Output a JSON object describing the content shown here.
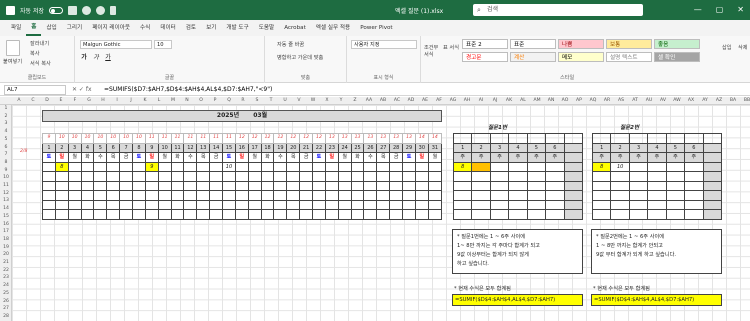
{
  "titlebar": {
    "autosave_label": "자동 저장",
    "filename": "엑셀 질문 (1).xlsx",
    "search_placeholder": "검색",
    "minimize": "—",
    "maximize": "▢",
    "close": "✕"
  },
  "menu": {
    "tabs": [
      "파일",
      "홈",
      "삽입",
      "그리기",
      "페이지 레이아웃",
      "수식",
      "데이터",
      "검토",
      "보기",
      "개발 도구",
      "도움말",
      "Acrobat",
      "엑셀 실무 적용",
      "Power Pivot"
    ],
    "active_index": 1
  },
  "ribbon": {
    "clipboard": {
      "paste": "붙여넣기",
      "cut": "잘라내기",
      "copy": "복사",
      "format_painter": "서식 복사",
      "label": "클립보드"
    },
    "font": {
      "name": "Malgun Gothic",
      "size": "10",
      "bold": "가",
      "italic": "가",
      "underline": "가",
      "label": "글꼴"
    },
    "alignment": {
      "wrap": "자동 줄 바꿈",
      "merge": "병합하고 가운데 맞춤",
      "label": "맞춤"
    },
    "number": {
      "format": "사용자 지정",
      "label": "표시 형식"
    },
    "conditional_format": "조건부 서식",
    "format_as_table": "표 서식",
    "styles": {
      "label": "스타일",
      "items": [
        {
          "text": "표준 2",
          "bg": "#ffffff",
          "color": "#000000"
        },
        {
          "text": "표준",
          "bg": "#ffffff",
          "color": "#000000"
        },
        {
          "text": "나쁨",
          "bg": "#ffc7ce",
          "color": "#9c0006"
        },
        {
          "text": "보통",
          "bg": "#ffeb9c",
          "color": "#9c5700"
        },
        {
          "text": "좋음",
          "bg": "#c6efce",
          "color": "#006100"
        },
        {
          "text": "경고문",
          "bg": "#ffffff",
          "color": "#ff0000"
        },
        {
          "text": "계산",
          "bg": "#f2f2f2",
          "color": "#fa7d00"
        },
        {
          "text": "메모",
          "bg": "#ffffcc",
          "color": "#000000"
        },
        {
          "text": "설명 텍스트",
          "bg": "#ffffff",
          "color": "#7f7f7f"
        },
        {
          "text": "셀 확인",
          "bg": "#a5a5a5",
          "color": "#ffffff"
        }
      ]
    },
    "insert": "삽입",
    "delete": "삭제"
  },
  "formula_bar": {
    "name_box": "AL7",
    "formula": "=SUMIFS($D7:$AH7,$D$4:$AH$4,AL$4,$D7:$AH7,\"<9\")"
  },
  "columns": [
    "A",
    "C",
    "D",
    "E",
    "F",
    "G",
    "H",
    "I",
    "J",
    "K",
    "L",
    "M",
    "N",
    "O",
    "P",
    "Q",
    "R",
    "S",
    "T",
    "U",
    "V",
    "W",
    "X",
    "Y",
    "Z",
    "AA",
    "AB",
    "AC",
    "AD",
    "AE",
    "AF",
    "AG",
    "AH",
    "AI",
    "AJ",
    "AK",
    "AL",
    "AM",
    "AN",
    "AO",
    "AP",
    "AQ",
    "AR",
    "AS",
    "AT",
    "AU",
    "AV",
    "AW",
    "AX",
    "AY",
    "AZ",
    "BA",
    "BB"
  ],
  "rows": [
    "1",
    "2",
    "3",
    "4",
    "5",
    "6",
    "7",
    "8",
    "9",
    "10",
    "11",
    "12",
    "13",
    "14",
    "15",
    "16",
    "17",
    "18",
    "19",
    "20",
    "21",
    "22",
    "23",
    "24",
    "25",
    "26",
    "27",
    "28"
  ],
  "sheet": {
    "title_year": "2025년",
    "title_month": "03월",
    "red_mark": "2/8",
    "week_nums": [
      "9",
      "10",
      "10",
      "10",
      "10",
      "10",
      "10",
      "10",
      "11",
      "11",
      "11",
      "11",
      "11",
      "11",
      "11",
      "12",
      "12",
      "12",
      "12",
      "12",
      "12",
      "12",
      "13",
      "13",
      "13",
      "13",
      "13",
      "13",
      "13",
      "14",
      "14"
    ],
    "days": [
      "1",
      "2",
      "3",
      "4",
      "5",
      "6",
      "7",
      "8",
      "9",
      "10",
      "11",
      "12",
      "13",
      "14",
      "15",
      "16",
      "17",
      "18",
      "19",
      "20",
      "21",
      "22",
      "23",
      "24",
      "25",
      "26",
      "27",
      "28",
      "29",
      "30",
      "31"
    ],
    "weekdays": [
      "토",
      "일",
      "월",
      "화",
      "수",
      "목",
      "금",
      "토",
      "일",
      "월",
      "화",
      "수",
      "목",
      "금",
      "토",
      "일",
      "월",
      "화",
      "수",
      "목",
      "금",
      "토",
      "일",
      "월",
      "화",
      "수",
      "목",
      "금",
      "토",
      "일",
      "월"
    ],
    "row7": [
      "",
      "8",
      "",
      "",
      "",
      "",
      "",
      "",
      "9",
      "",
      "",
      "",
      "",
      "",
      "10"
    ],
    "week1": {
      "title": "질문1번",
      "nums": [
        "1",
        "2",
        "3",
        "4",
        "5",
        "6"
      ],
      "label": "주",
      "row7": [
        "8",
        ""
      ]
    },
    "week2": {
      "title": "질문2번",
      "nums": [
        "1",
        "2",
        "3",
        "4",
        "5",
        "6"
      ],
      "label": "주",
      "row7": [
        "8",
        "10"
      ]
    },
    "note1": {
      "line1": "* 질문1번에는 1 ~ 6주 사이에",
      "line2": "1~ 8만 까지는 각 주마다 합계가 되고",
      "line3": "9값 이상부터는 합계가 되지 않게",
      "line4": "하고 싶습니다."
    },
    "note2": {
      "line1": "* 질문2번에는 1 ~ 6주 사이에",
      "line2": "1 ~ 8만 까지는 합계가 안되고",
      "line3": "9값 부터 합계가 되게 하고 싶습니다."
    },
    "formula_title": "* 현재 수식은 모두 합계됨",
    "formula_left": "=SUMIF($D$4:$AH$4,AL$4,$D7:$AH7)",
    "formula_right": "=SUMIF($D$4:$AH$4,AL$4,$D7:$AH7)"
  }
}
